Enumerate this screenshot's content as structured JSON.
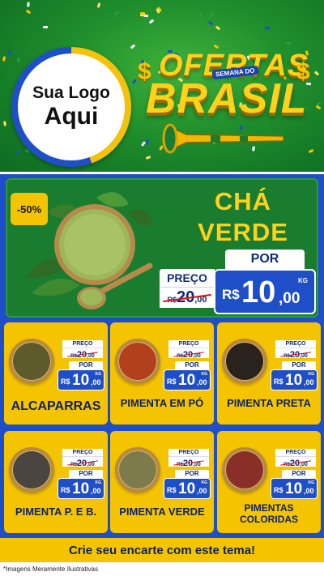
{
  "header": {
    "logo_line1": "Sua Logo",
    "logo_line2": "Aqui",
    "title_top": "OFERTAS",
    "title_tag": "SEMANA DO",
    "title_main": "BRASIL",
    "currency_symbol": "$"
  },
  "hero": {
    "discount": "-50%",
    "title_line1": "CHÁ",
    "title_line2": "VERDE",
    "price_label": "PREÇO",
    "old_currency": "R$",
    "old_int": "20",
    "old_dec": ",00",
    "por_label": "POR",
    "new_currency": "R$",
    "new_int": "10",
    "new_dec": ",00",
    "unit": "KG"
  },
  "price_common": {
    "price_label": "PREÇO",
    "old_currency": "R$",
    "old_int": "20",
    "old_dec": ",00",
    "por_label": "POR",
    "new_currency": "R$",
    "new_int": "10",
    "new_dec": ",00",
    "unit": "KG"
  },
  "products": [
    {
      "name": "ALCAPARRAS",
      "color": "#5d5a2c"
    },
    {
      "name": "PIMENTA EM PÓ",
      "color": "#b2401d"
    },
    {
      "name": "PIMENTA PRETA",
      "color": "#2a221d"
    },
    {
      "name": "PIMENTA P. E B.",
      "color": "#4a4540"
    },
    {
      "name": "PIMENTA VERDE",
      "color": "#7d7b4b"
    },
    {
      "name_line1": "PIMENTAS",
      "name_line2": "COLORIDAS",
      "color": "#8a2e28"
    }
  ],
  "footer": {
    "cta": "Crie seu encarte com este tema!",
    "disclaimer": "*Imagens Meramente Ilustrativas"
  },
  "colors": {
    "green": "#1a7c2f",
    "blue": "#1f4fc8",
    "yellow": "#f5c400",
    "navy": "#0f2260"
  }
}
